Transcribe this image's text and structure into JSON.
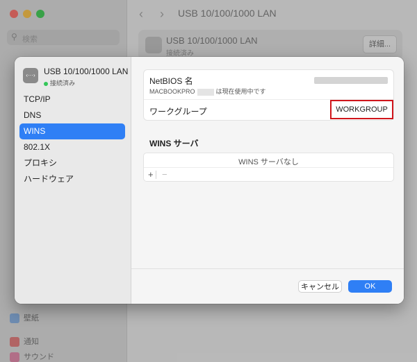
{
  "background": {
    "search_placeholder": "検索",
    "header_title": "USB 10/100/1000 LAN",
    "card": {
      "name": "USB 10/100/1000 LAN",
      "status": "接続済み",
      "details_button": "詳細..."
    },
    "sidebar_rows": [
      "壁紙",
      "通知",
      "サウンド"
    ]
  },
  "sheet": {
    "device": {
      "name": "USB 10/100/1000 LAN",
      "status": "接続済み",
      "icon": "network-icon"
    },
    "nav": [
      {
        "label": "TCP/IP",
        "active": false
      },
      {
        "label": "DNS",
        "active": false
      },
      {
        "label": "WINS",
        "active": true
      },
      {
        "label": "802.1X",
        "active": false
      },
      {
        "label": "プロキシ",
        "active": false
      },
      {
        "label": "ハードウェア",
        "active": false
      }
    ],
    "netbios": {
      "label": "NetBIOS 名",
      "sub_prefix": "MACBOOKPRO",
      "sub_suffix": "は現在使用中です"
    },
    "workgroup": {
      "label": "ワークグループ",
      "value": "WORKGROUP"
    },
    "wins": {
      "heading": "WINS サーバ",
      "empty": "WINS サーバなし",
      "add": "+",
      "remove": "−"
    },
    "buttons": {
      "cancel": "キャンセル",
      "ok": "OK"
    }
  },
  "colors": {
    "accent": "#2f7ff5",
    "highlight_border": "#d0151b",
    "connected": "#34c759"
  }
}
